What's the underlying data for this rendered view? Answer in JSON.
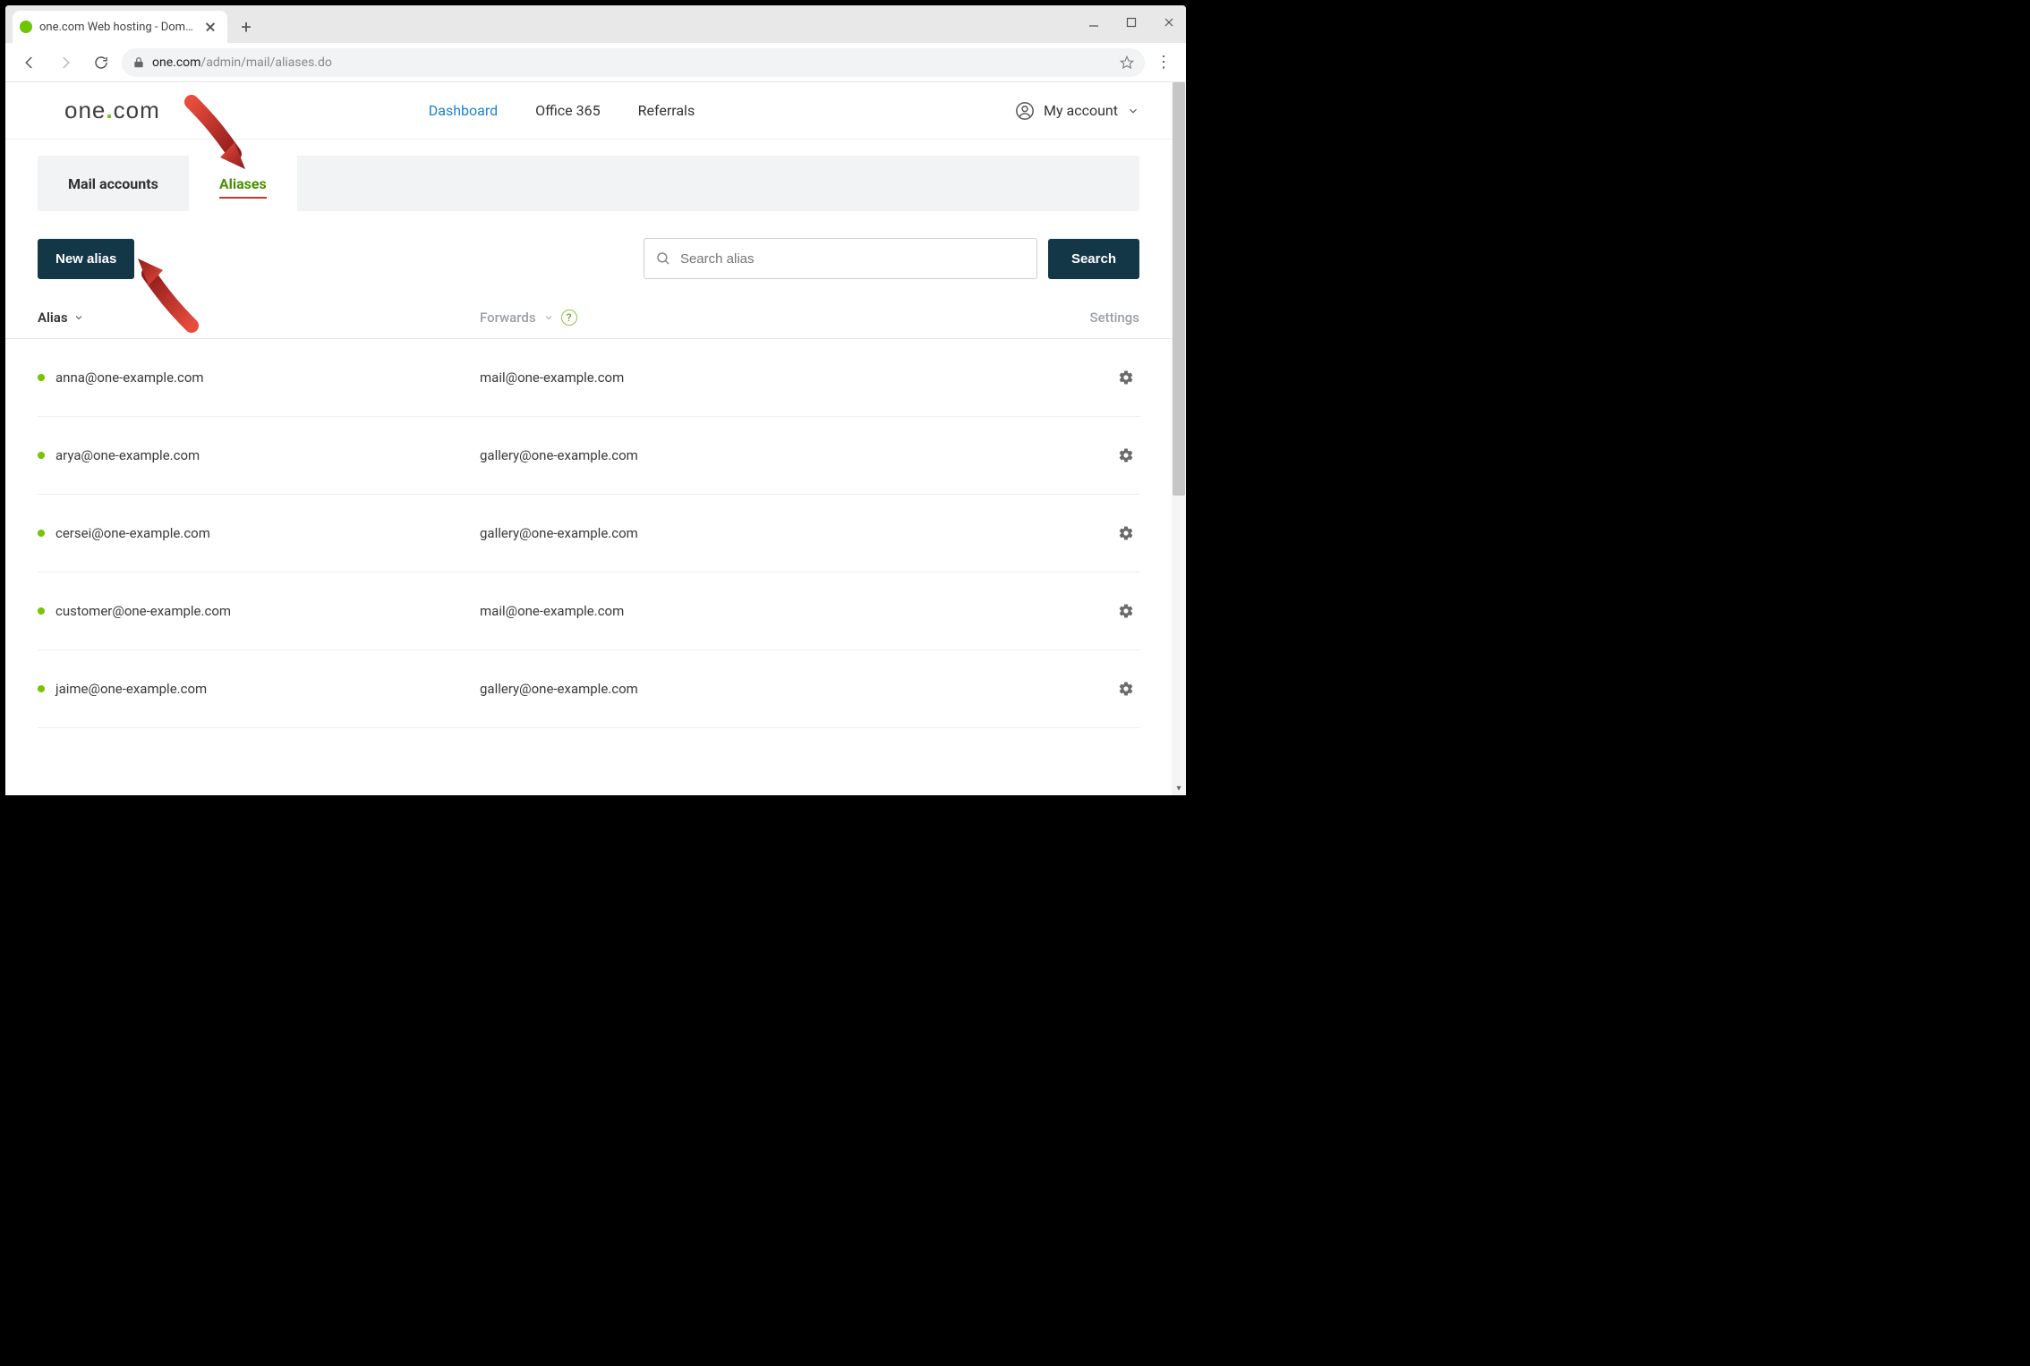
{
  "browser": {
    "tab_title": "one.com Web hosting  -  Domain…",
    "url_domain": "one.com",
    "url_path": "/admin/mail/aliases.do"
  },
  "header": {
    "logo_one": "one",
    "logo_com": "com",
    "nav": {
      "dashboard": "Dashboard",
      "office365": "Office 365",
      "referrals": "Referrals"
    },
    "account_label": "My account"
  },
  "subtabs": {
    "mail_accounts": "Mail accounts",
    "aliases": "Aliases"
  },
  "toolbar": {
    "new_alias": "New alias",
    "search_placeholder": "Search alias",
    "search_button": "Search"
  },
  "table": {
    "head_alias": "Alias",
    "head_forwards": "Forwards",
    "head_settings": "Settings",
    "rows": [
      {
        "alias": "anna@one-example.com",
        "forward": "mail@one-example.com"
      },
      {
        "alias": "arya@one-example.com",
        "forward": "gallery@one-example.com"
      },
      {
        "alias": "cersei@one-example.com",
        "forward": "gallery@one-example.com"
      },
      {
        "alias": "customer@one-example.com",
        "forward": "mail@one-example.com"
      },
      {
        "alias": "jaime@one-example.com",
        "forward": "gallery@one-example.com"
      }
    ]
  }
}
